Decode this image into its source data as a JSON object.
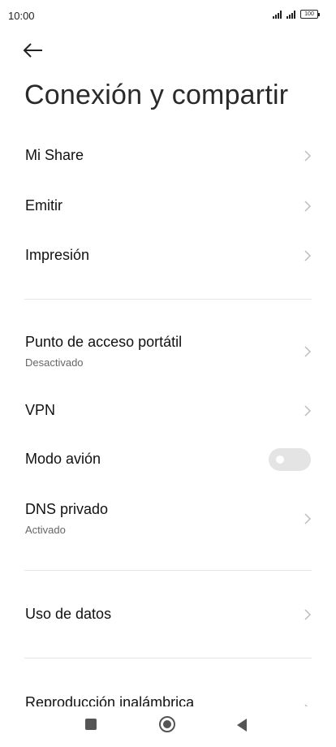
{
  "status_bar": {
    "time": "10:00",
    "battery_level": "100"
  },
  "page": {
    "title": "Conexión y compartir"
  },
  "items": [
    {
      "label": "Mi Share"
    },
    {
      "label": "Emitir"
    },
    {
      "label": "Impresión"
    },
    {
      "label": "Punto de acceso portátil",
      "subtitle": "Desactivado"
    },
    {
      "label": "VPN"
    },
    {
      "label": "Modo avión",
      "toggle_on": false
    },
    {
      "label": "DNS privado",
      "subtitle": "Activado"
    },
    {
      "label": "Uso de datos"
    },
    {
      "label": "Reproducción inalámbrica"
    }
  ],
  "icons": {
    "back": "arrow-left-icon",
    "chevron": "chevron-right-icon",
    "nav_recents": "square-icon",
    "nav_home": "circle-icon",
    "nav_back": "triangle-left-icon"
  },
  "colors": {
    "toggle_off": "#e4e4e4",
    "chevron": "#bdbdbd"
  }
}
